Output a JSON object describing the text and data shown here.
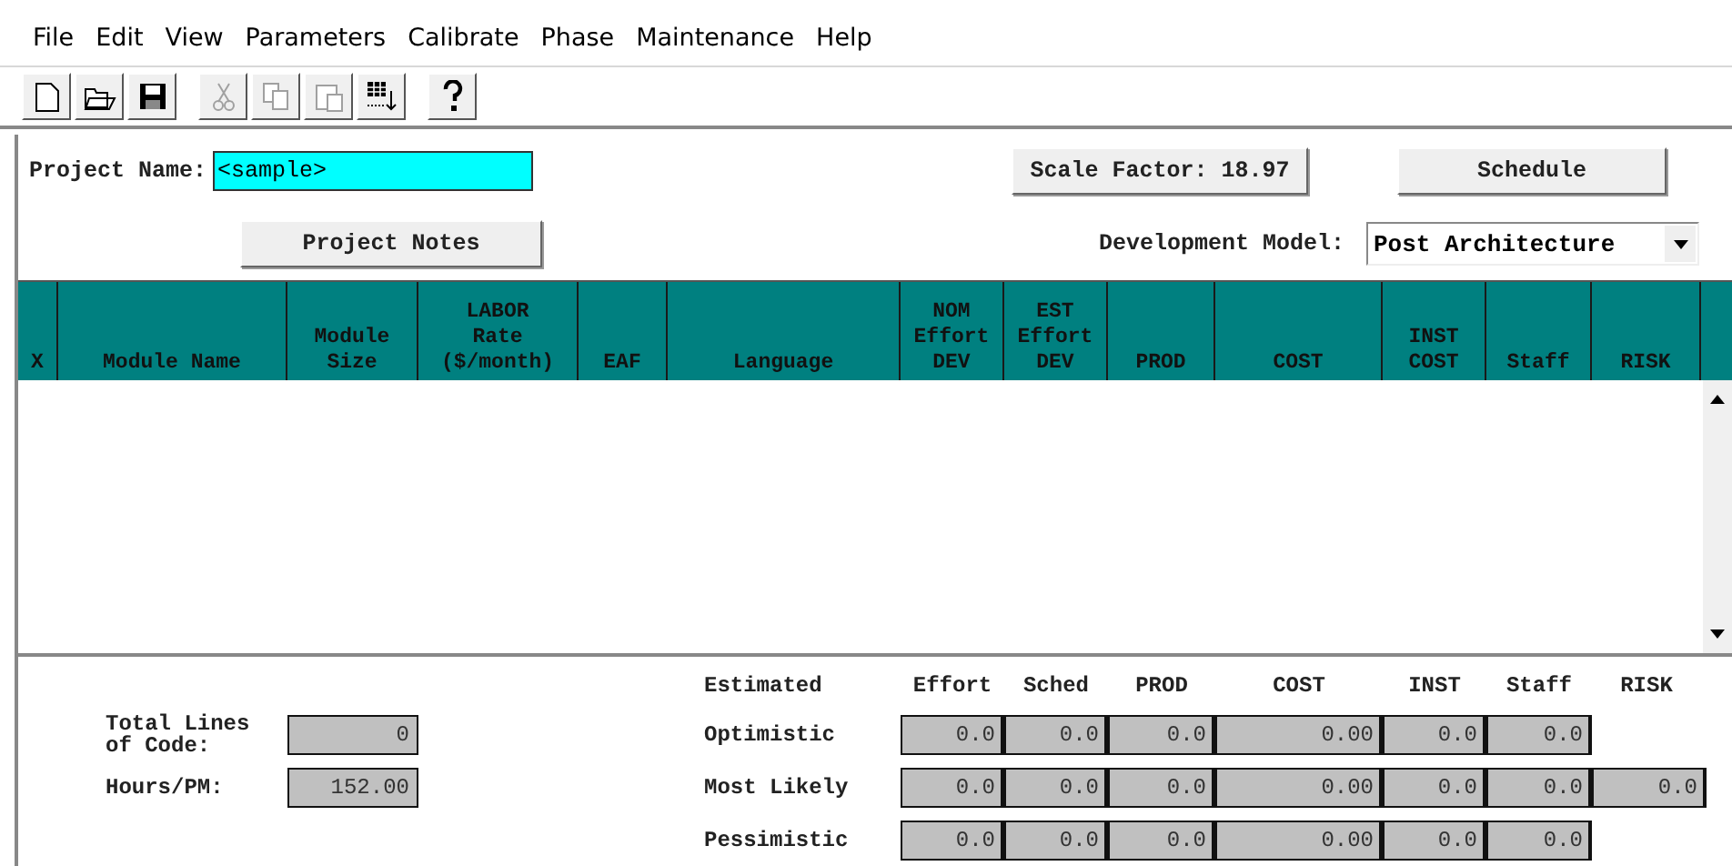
{
  "menu": [
    "File",
    "Edit",
    "View",
    "Parameters",
    "Calibrate",
    "Phase",
    "Maintenance",
    "Help"
  ],
  "toolbar": [
    {
      "kind": "new",
      "disabled": false
    },
    {
      "kind": "open",
      "disabled": false
    },
    {
      "kind": "save",
      "disabled": false
    },
    {
      "kind": "cut",
      "disabled": true
    },
    {
      "kind": "copy",
      "disabled": true
    },
    {
      "kind": "paste",
      "disabled": true
    },
    {
      "kind": "grid",
      "disabled": false
    },
    {
      "kind": "help",
      "disabled": false
    }
  ],
  "project": {
    "label": "Project Name:",
    "value": "<sample>"
  },
  "project_notes": "Project Notes",
  "scale_factor": "Scale Factor: 18.97",
  "schedule": "Schedule",
  "development_model": {
    "label": "Development Model:",
    "value": "Post Architecture"
  },
  "table": {
    "columns": [
      {
        "lines": [
          "X"
        ]
      },
      {
        "lines": [
          "Module Name"
        ]
      },
      {
        "lines": [
          "Module",
          "Size"
        ]
      },
      {
        "lines": [
          "LABOR",
          "Rate",
          "($/month)"
        ]
      },
      {
        "lines": [
          "EAF"
        ]
      },
      {
        "lines": [
          "Language"
        ]
      },
      {
        "lines": [
          "NOM",
          "Effort",
          "DEV"
        ]
      },
      {
        "lines": [
          "EST",
          "Effort",
          "DEV"
        ]
      },
      {
        "lines": [
          "PROD"
        ]
      },
      {
        "lines": [
          "COST"
        ]
      },
      {
        "lines": [
          "INST",
          "COST"
        ]
      },
      {
        "lines": [
          "Staff"
        ]
      },
      {
        "lines": [
          "RISK"
        ]
      }
    ]
  },
  "totals": [
    {
      "label": "Total Lines of Code:",
      "value": "0"
    },
    {
      "label": "Hours/PM:",
      "value": "152.00"
    }
  ],
  "summary": {
    "title": "Estimated",
    "headers": [
      "Effort",
      "Sched",
      "PROD",
      "COST",
      "INST",
      "Staff",
      "RISK"
    ],
    "rows": [
      {
        "label": "Optimistic",
        "values": [
          "0.0",
          "0.0",
          "0.0",
          "0.00",
          "0.0",
          "0.0"
        ]
      },
      {
        "label": "Most Likely",
        "values": [
          "0.0",
          "0.0",
          "0.0",
          "0.00",
          "0.0",
          "0.0",
          "0.0"
        ]
      },
      {
        "label": "Pessimistic",
        "values": [
          "0.0",
          "0.0",
          "0.0",
          "0.00",
          "0.0",
          "0.0"
        ]
      }
    ]
  }
}
